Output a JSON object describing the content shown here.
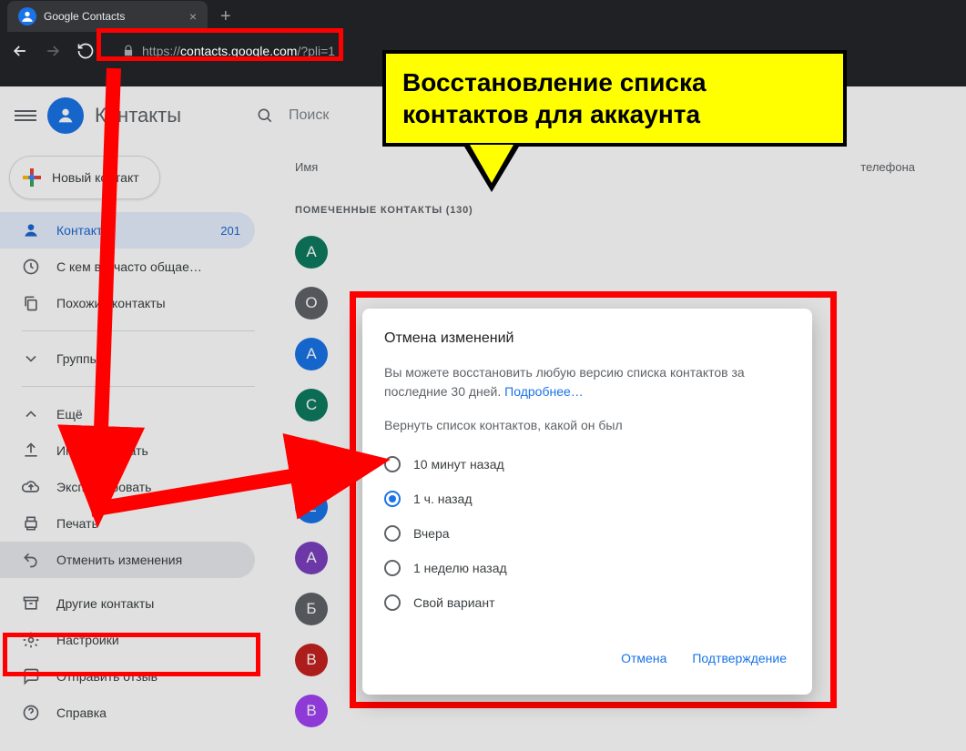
{
  "browser": {
    "tab_title": "Google Contacts",
    "url_proto": "https://",
    "url_domain": "contacts.google.com",
    "url_path": "/?pli=1"
  },
  "app": {
    "title": "Контакты",
    "search_placeholder": "Поиск",
    "new_contact": "Новый контакт"
  },
  "sidebar": {
    "contacts": "Контакты",
    "contacts_count": "201",
    "frequent": "С кем вы часто общае…",
    "similar": "Похожие контакты",
    "groups": "Группы",
    "more": "Ещё",
    "import": "Импортировать",
    "export": "Экспортировать",
    "print": "Печать",
    "undo": "Отменить изменения",
    "other": "Другие контакты",
    "settings": "Настройки",
    "feedback": "Отправить отзыв",
    "help": "Справка"
  },
  "columns": {
    "name": "Имя",
    "phone": "телефона"
  },
  "section_label": "ПОМЕЧЕННЫЕ КОНТАКТЫ (130)",
  "avatars": [
    {
      "t": "A",
      "c": "#0d7a5f"
    },
    {
      "t": "O",
      "c": "#5f6368"
    },
    {
      "t": "A",
      "c": "#1a73e8"
    },
    {
      "t": "C",
      "c": "#0d7a5f"
    },
    {
      "t": "А",
      "c": "#e8710a"
    },
    {
      "t": "E",
      "c": "#1a73e8"
    },
    {
      "t": "А",
      "c": "#7b3fbf"
    },
    {
      "t": "Б",
      "c": "#5f6368"
    },
    {
      "t": "B",
      "c": "#c5221f"
    },
    {
      "t": "B",
      "c": "#a142f4"
    }
  ],
  "dialog": {
    "title": "Отмена изменений",
    "desc_a": "Вы можете восстановить любую версию списка контактов за последние 30 дней. ",
    "more": "Подробнее…",
    "subhead": "Вернуть список контактов, какой он был",
    "opt_10m": "10 минут назад",
    "opt_1h": "1 ч. назад",
    "opt_yest": "Вчера",
    "opt_1w": "1 неделю назад",
    "opt_custom": "Свой вариант",
    "cancel": "Отмена",
    "confirm": "Подтверждение"
  },
  "callout": "Восстановление списка контактов для аккаунта"
}
